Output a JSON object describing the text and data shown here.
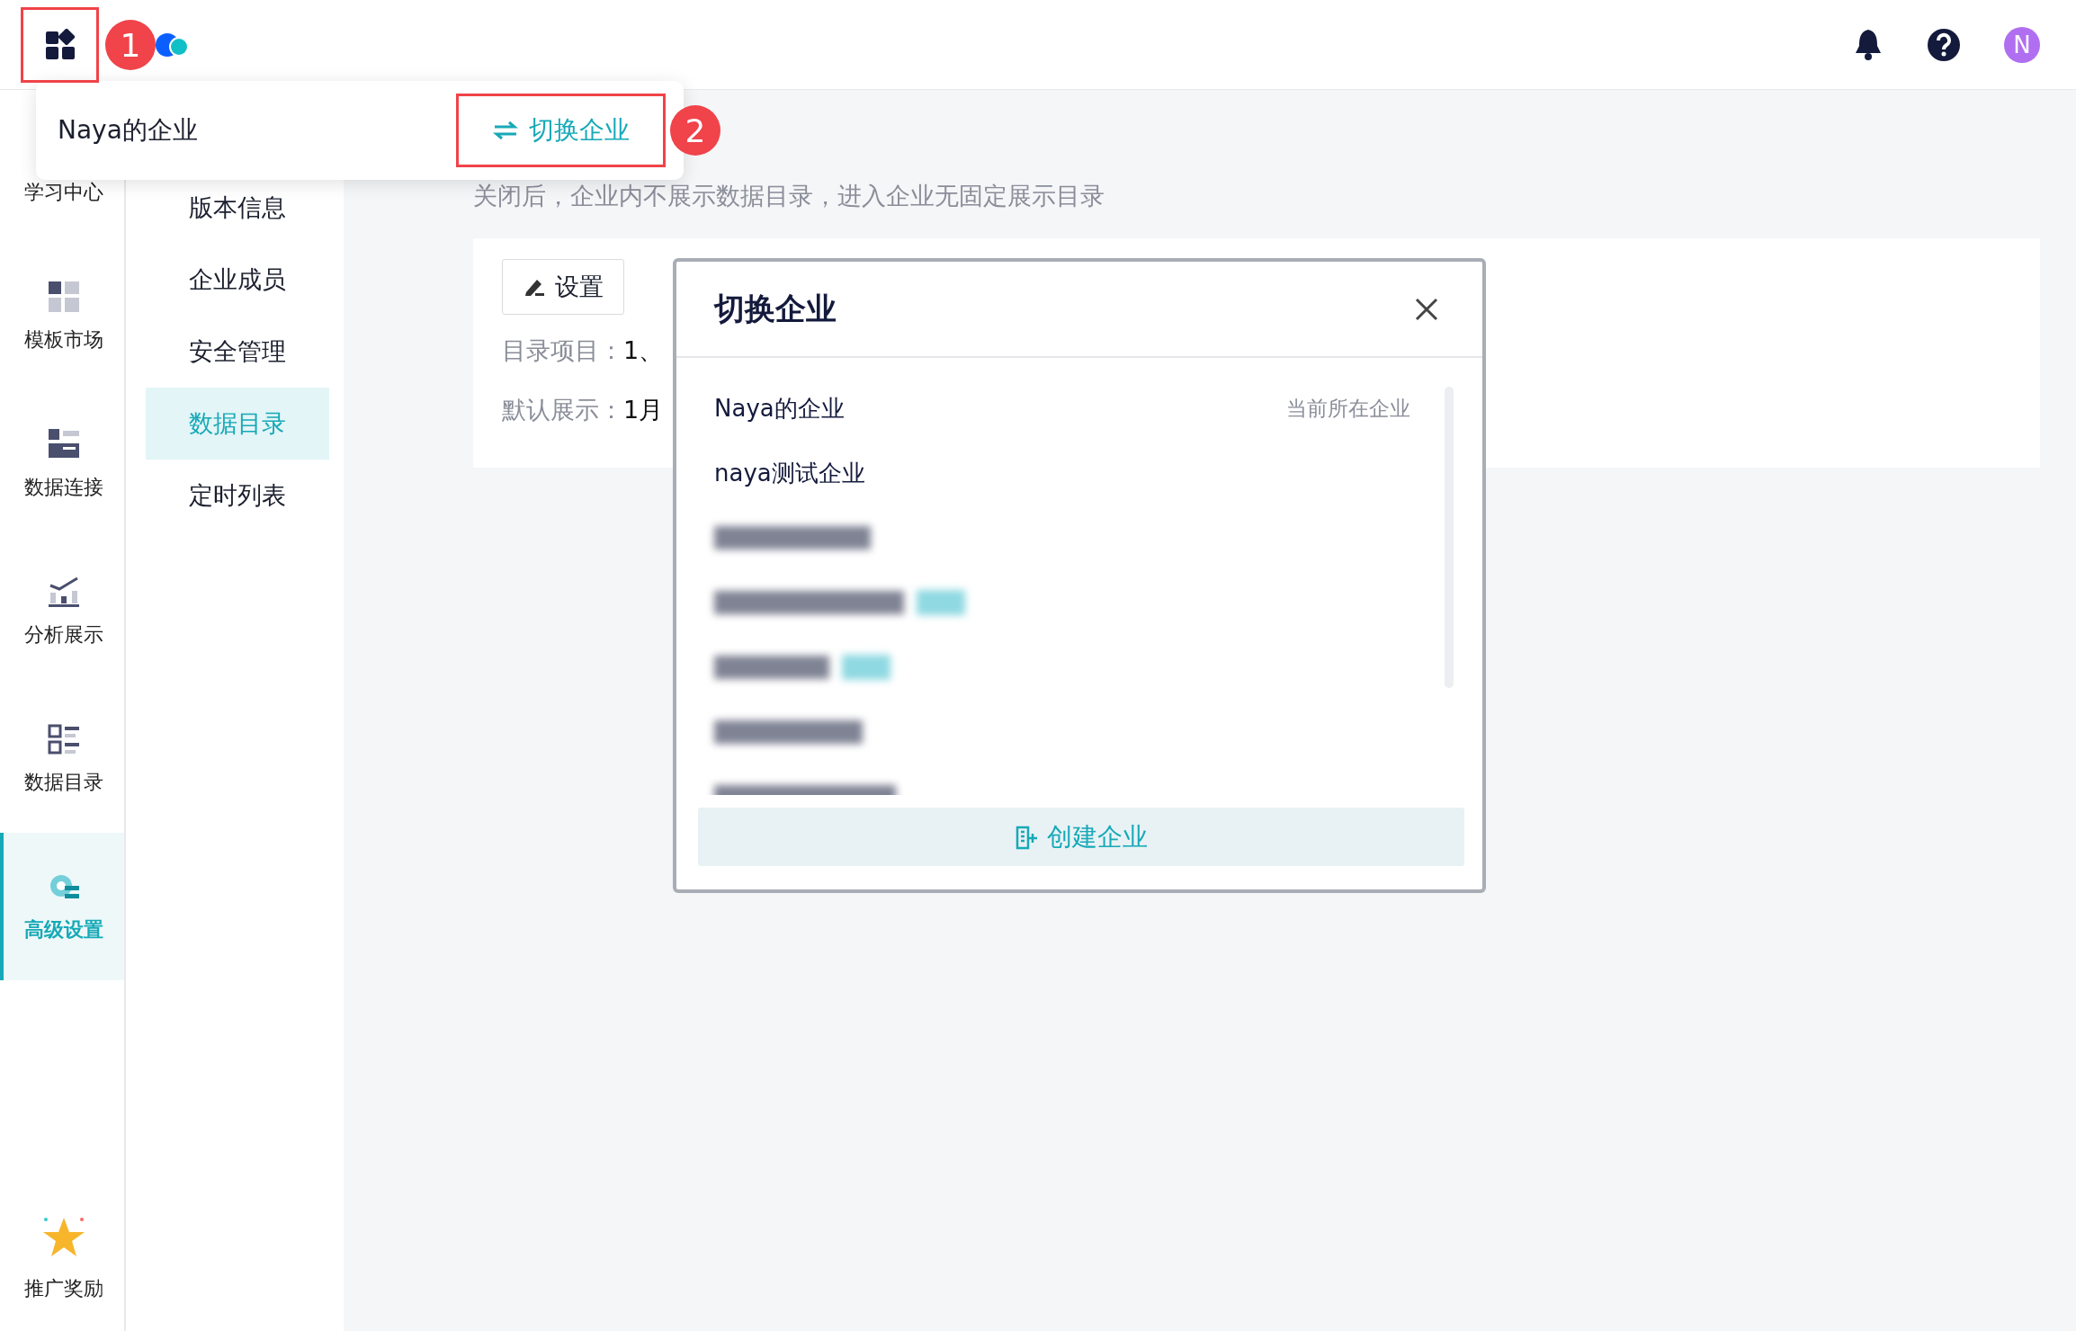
{
  "topbar": {
    "avatar": "N"
  },
  "nav": [
    {
      "label": "学习中心",
      "selected": false
    },
    {
      "label": "模板市场",
      "selected": false
    },
    {
      "label": "数据连接",
      "selected": false
    },
    {
      "label": "分析展示",
      "selected": false
    },
    {
      "label": "数据目录",
      "selected": false
    },
    {
      "label": "高级设置",
      "selected": true
    }
  ],
  "nav_bottom": {
    "label": "推广奖励"
  },
  "subnav": [
    {
      "label": "版本信息",
      "selected": false
    },
    {
      "label": "企业成员",
      "selected": false
    },
    {
      "label": "安全管理",
      "selected": false
    },
    {
      "label": "数据目录",
      "selected": true
    },
    {
      "label": "定时列表",
      "selected": false
    }
  ],
  "content": {
    "description": "关闭后，企业内不展示数据目录，进入企业无固定展示目录",
    "settings_button": "设置",
    "fields": [
      {
        "label": "目录项目：",
        "value": "1、"
      },
      {
        "label": "默认展示：",
        "value": "1月"
      }
    ]
  },
  "popover": {
    "company": "Naya的企业",
    "switch_button": "切换企业"
  },
  "annotations": [
    {
      "number": "1"
    },
    {
      "number": "2"
    }
  ],
  "dialog": {
    "title": "切换企业",
    "items": [
      {
        "kind": "text",
        "name": "Naya的企业",
        "note": "当前所在企业"
      },
      {
        "kind": "text",
        "name": "naya测试企业"
      },
      {
        "kind": "blurred",
        "tagged": false
      },
      {
        "kind": "blurred",
        "tagged": true
      },
      {
        "kind": "blurred",
        "tagged": true
      },
      {
        "kind": "blurred",
        "tagged": false
      },
      {
        "kind": "blurred",
        "tagged": false
      }
    ],
    "create_button": "创建企业"
  }
}
